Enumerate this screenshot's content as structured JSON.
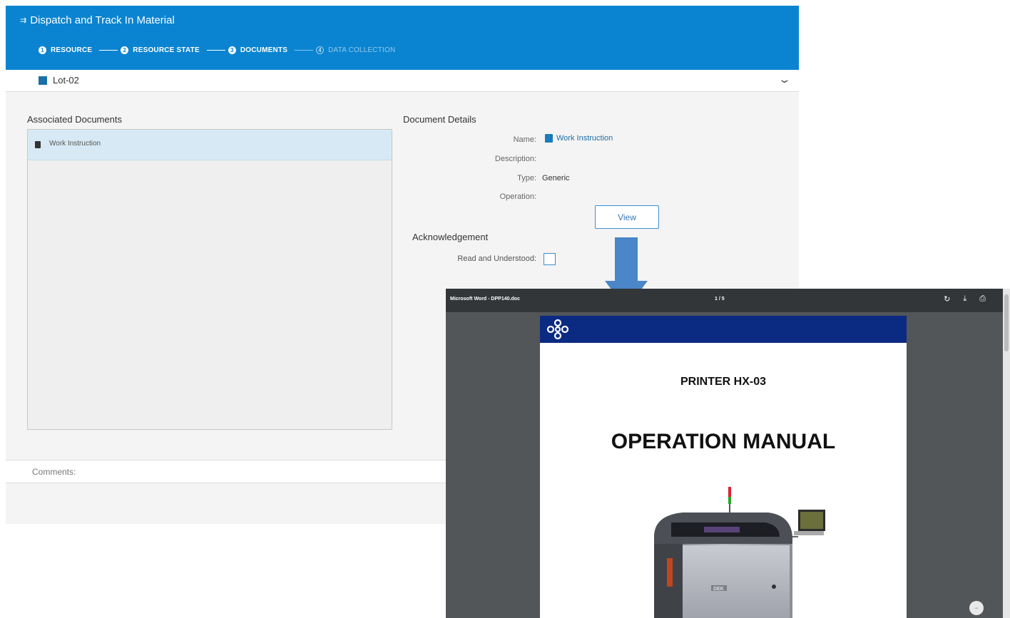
{
  "app": {
    "title": "Dispatch and Track In Material",
    "steps": [
      {
        "num": "1",
        "label": "RESOURCE",
        "state": "done"
      },
      {
        "num": "2",
        "label": "RESOURCE STATE",
        "state": "done"
      },
      {
        "num": "3",
        "label": "DOCUMENTS",
        "state": "active"
      },
      {
        "num": "4",
        "label": "DATA COLLECTION",
        "state": "pending"
      }
    ],
    "lot": "Lot-02"
  },
  "associated_documents": {
    "title": "Associated Documents",
    "items": [
      "Work Instruction"
    ]
  },
  "document_details": {
    "title": "Document Details",
    "name_label": "Name:",
    "name_value": "Work Instruction",
    "description_label": "Description:",
    "type_label": "Type:",
    "type_value": "Generic",
    "operation_label": "Operation:",
    "view_button": "View"
  },
  "acknowledgement": {
    "title": "Acknowledgement",
    "read_label": "Read and Understood:",
    "checked": false
  },
  "comments": {
    "label": "Comments:"
  },
  "pdf_viewer": {
    "title": "Microsoft Word - DPP140.doc",
    "pages": "1 / 5",
    "tools": [
      "rotate-icon",
      "download-icon",
      "print-icon"
    ],
    "doc_subtitle": "PRINTER HX-03",
    "doc_title": "OPERATION MANUAL",
    "printer_brand": "DEK"
  },
  "colors": {
    "header": "#0a84d0",
    "accent": "#1a6fa6",
    "selected_row": "#d7e9f4",
    "arrow": "#4a86c8",
    "pdf_banner": "#0b2a82"
  }
}
